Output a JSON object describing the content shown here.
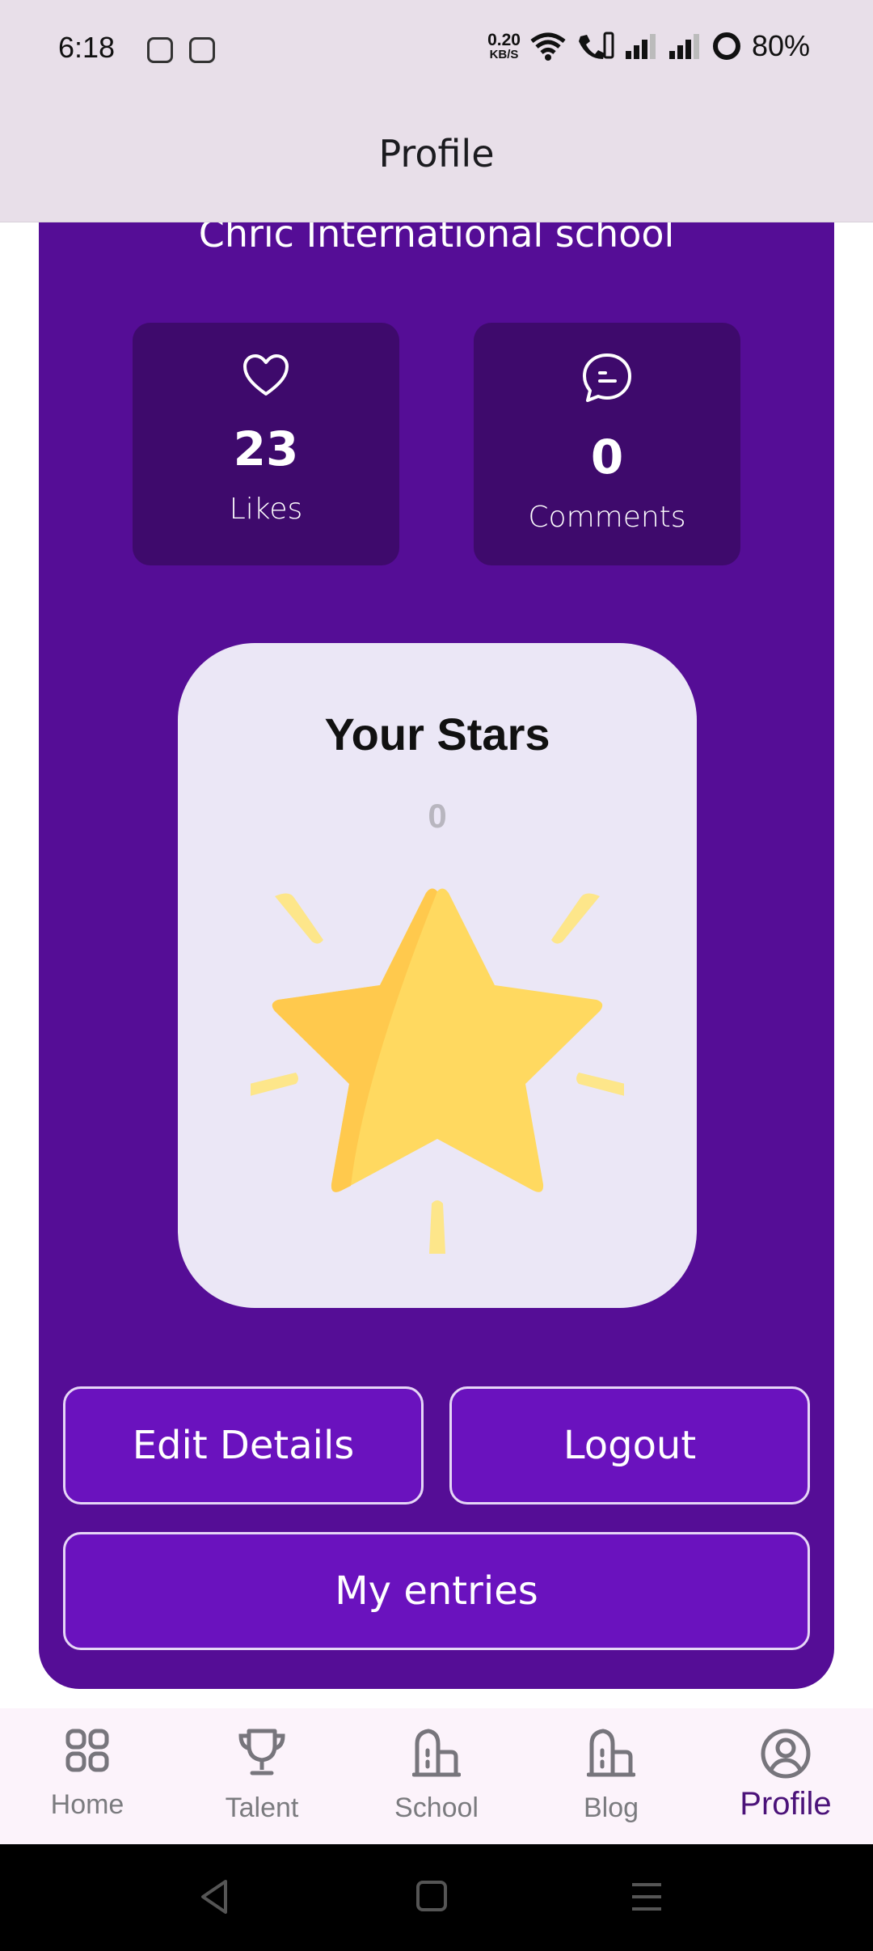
{
  "status_bar": {
    "time": "6:18",
    "net_speed_value": "0.20",
    "net_speed_unit": "KB/S",
    "battery": "80%"
  },
  "header": {
    "title": "Profile"
  },
  "profile": {
    "school_name": "Chric International school",
    "likes": {
      "value": "23",
      "label": "Likes"
    },
    "comments": {
      "value": "0",
      "label": "Comments"
    }
  },
  "stars": {
    "title": "Your Stars",
    "count": "0"
  },
  "buttons": {
    "edit": "Edit Details",
    "logout": "Logout",
    "entries": "My entries"
  },
  "bottom_nav": {
    "items": [
      {
        "label": "Home",
        "icon": "grid-icon"
      },
      {
        "label": "Talent",
        "icon": "trophy-icon"
      },
      {
        "label": "School",
        "icon": "building-icon"
      },
      {
        "label": "Blog",
        "icon": "building-icon"
      },
      {
        "label": "Profile",
        "icon": "account-circle-icon"
      }
    ],
    "active": "Profile"
  },
  "colors": {
    "card_purple": "#550d96",
    "stat_box": "#3e0a6c",
    "button_purple": "#6a12be",
    "header_bg": "#e8dfe9",
    "star_yellow": "#ffd960"
  }
}
